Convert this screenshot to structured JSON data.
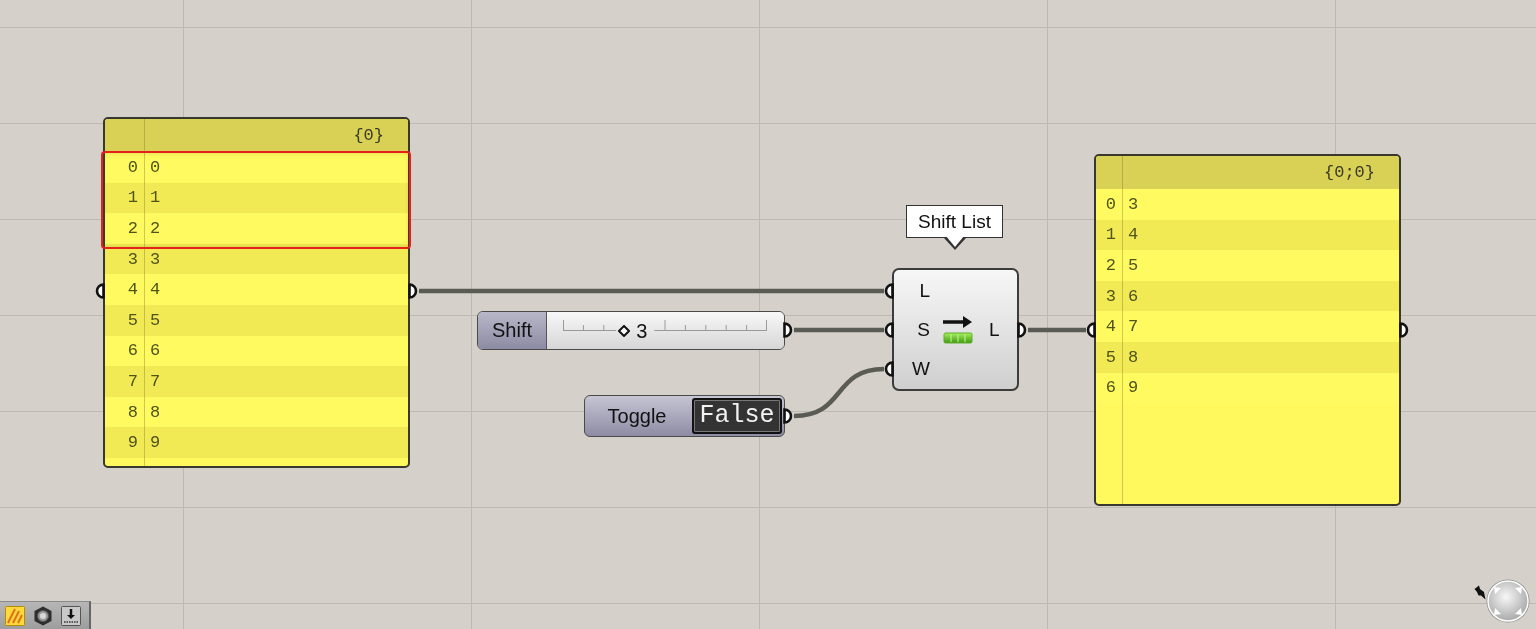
{
  "canvas": {
    "panels": [
      {
        "path": "{0}",
        "rows": [
          {
            "index": "0",
            "value": "0",
            "highlighted": true
          },
          {
            "index": "1",
            "value": "1",
            "highlighted": true
          },
          {
            "index": "2",
            "value": "2",
            "highlighted": true
          },
          {
            "index": "3",
            "value": "3",
            "highlighted": false
          },
          {
            "index": "4",
            "value": "4",
            "highlighted": false
          },
          {
            "index": "5",
            "value": "5",
            "highlighted": false
          },
          {
            "index": "6",
            "value": "6",
            "highlighted": false
          },
          {
            "index": "7",
            "value": "7",
            "highlighted": false
          },
          {
            "index": "8",
            "value": "8",
            "highlighted": false
          },
          {
            "index": "9",
            "value": "9",
            "highlighted": false
          }
        ]
      },
      {
        "path": "{0;0}",
        "rows": [
          {
            "index": "0",
            "value": "3",
            "highlighted": false
          },
          {
            "index": "1",
            "value": "4",
            "highlighted": false
          },
          {
            "index": "2",
            "value": "5",
            "highlighted": false
          },
          {
            "index": "3",
            "value": "6",
            "highlighted": false
          },
          {
            "index": "4",
            "value": "7",
            "highlighted": false
          },
          {
            "index": "5",
            "value": "8",
            "highlighted": false
          },
          {
            "index": "6",
            "value": "9",
            "highlighted": false
          }
        ]
      }
    ],
    "slider": {
      "label": "Shift",
      "value": "3",
      "level": 0.3
    },
    "toggle": {
      "label": "Toggle",
      "value": "False"
    },
    "component": {
      "tooltip": "Shift List",
      "inputs": [
        "L",
        "S",
        "W"
      ],
      "outputs": [
        "L"
      ]
    }
  }
}
